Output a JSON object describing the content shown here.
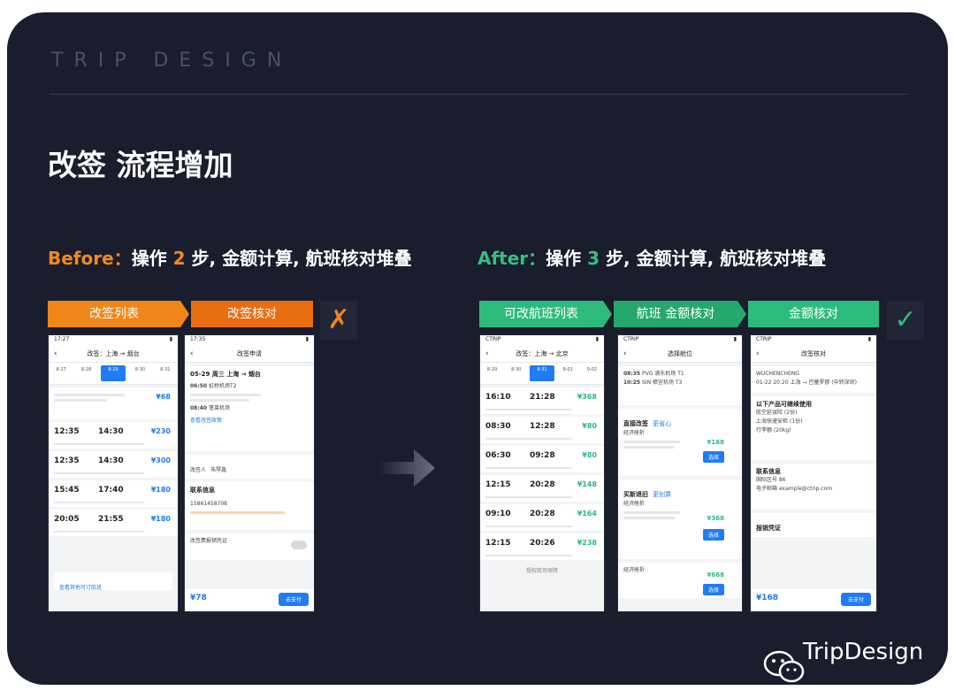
{
  "brand": "TRIP DESIGN",
  "title": "改签 流程增加",
  "before": {
    "label": "Before：",
    "text_a": "操作 ",
    "count": "2",
    "text_b": " 步, 金额计算, 航班核对堆叠",
    "steps": [
      "改签列表",
      "改签核对"
    ],
    "mark": "✗"
  },
  "after": {
    "label": "After：",
    "text_a": "操作 ",
    "count": "3",
    "text_b": " 步, 金额计算, 航班核对堆叠",
    "steps": [
      "可改航班列表",
      "航班 金额核对",
      "金额核对"
    ],
    "mark": "✓"
  },
  "phones": {
    "p1": {
      "time": "17:27",
      "nav": "改签：上海 → 烟台",
      "dates": [
        "8-27",
        "8-28",
        "8-29",
        "8-30",
        "8-31"
      ],
      "flights": [
        {
          "dep": "12:35",
          "arr": "14:30",
          "price": "¥230"
        },
        {
          "dep": "12:35",
          "arr": "14:30",
          "price": "¥300"
        },
        {
          "dep": "15:45",
          "arr": "17:40",
          "price": "¥180"
        },
        {
          "dep": "20:05",
          "arr": "21:55",
          "price": "¥180"
        }
      ],
      "head_price": "¥68",
      "footer": "查看其他可订航班"
    },
    "p2": {
      "time": "17:35",
      "nav": "改签申请",
      "route": "05-29 周三 上海 → 烟台",
      "dep": "06:50",
      "dep_apt": "虹桥机场T2",
      "arr": "08:40",
      "arr_apt": "蓬莱机场",
      "link": "查看改签政策",
      "passenger_label": "改签人",
      "passenger": "朱琴鑫",
      "contact_title": "联系信息",
      "phone": "15861458708",
      "voucher": "改签费报销凭证",
      "price": "¥78",
      "pay": "去支付"
    },
    "p3": {
      "time": "CTRIP",
      "nav": "改签：上海 → 北京",
      "dates": [
        "8-29",
        "8-30",
        "8-31",
        "9-01",
        "9-02"
      ],
      "flights": [
        {
          "dep": "16:10",
          "arr": "21:28",
          "price": "¥368"
        },
        {
          "dep": "08:30",
          "arr": "12:28",
          "price": "¥80"
        },
        {
          "dep": "06:30",
          "arr": "09:28",
          "price": "¥80"
        },
        {
          "dep": "12:15",
          "arr": "20:28",
          "price": "¥148"
        },
        {
          "dep": "09:10",
          "arr": "20:28",
          "price": "¥164"
        },
        {
          "dep": "12:15",
          "arr": "20:26",
          "price": "¥238"
        }
      ],
      "footer": "授权航司保障"
    },
    "p4": {
      "time": "CTRIP",
      "nav": "选择舱位",
      "dep": "08:35",
      "dep_apt": "PVG 浦东机场 T1",
      "arr": "10:25",
      "arr_apt": "SIN 樟宜机场 T3",
      "sec1": "直接改签",
      "sec1_tag": "更省心",
      "sec2": "买新退旧",
      "sec2_tag": "更划算",
      "cabin": "经济舱折",
      "price1": "¥168",
      "price2": "¥368",
      "price3": "¥668",
      "select": "选择"
    },
    "p5": {
      "time": "CTRIP",
      "nav": "改签核对",
      "name": "WUCHENCHENG",
      "route": "01-22 20:20 上海 → 巴塞罗那 (中转深圳)",
      "sec": "以下产品可继续使用",
      "items": [
        "航空延误险 (2份)",
        "上海快速安检 (1份)",
        "行李额 (20kg)"
      ],
      "contact_title": "联系信息",
      "cc_label": "国际区号 86",
      "email_label": "电子邮箱",
      "email": "example@ctrip.com",
      "voucher": "报销凭证",
      "price": "¥168",
      "pay": "去支付"
    }
  },
  "footer_brand": "TripDesign"
}
